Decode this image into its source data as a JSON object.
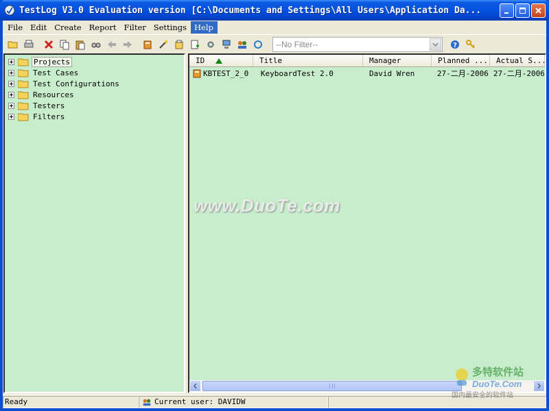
{
  "window": {
    "title": "TestLog V3.0 Evaluation version  [C:\\Documents and Settings\\All Users\\Application Da..."
  },
  "menu": {
    "items": [
      {
        "label": "File"
      },
      {
        "label": "Edit"
      },
      {
        "label": "Create"
      },
      {
        "label": "Report"
      },
      {
        "label": "Filter"
      },
      {
        "label": "Settings"
      },
      {
        "label": "Help",
        "active": true
      }
    ]
  },
  "toolbar": {
    "filter_value": "--No Filter--",
    "icons": [
      "open-folder-icon",
      "print-icon",
      "delete-icon",
      "copy-icon",
      "paste-icon",
      "find-icon",
      "back-arrow-icon",
      "forward-arrow-icon",
      "project-icon",
      "wand-icon",
      "test-case-icon",
      "new-icon",
      "settings-icon",
      "network-icon",
      "users-icon",
      "refresh-icon",
      "help-icon",
      "key-icon"
    ]
  },
  "tree": {
    "items": [
      {
        "label": "Projects",
        "selected": true
      },
      {
        "label": "Test Cases"
      },
      {
        "label": "Test Configurations"
      },
      {
        "label": "Resources"
      },
      {
        "label": "Testers"
      },
      {
        "label": "Filters"
      }
    ]
  },
  "list": {
    "columns": [
      "ID",
      "Title",
      "Manager",
      "Planned ...",
      "Actual S..."
    ],
    "rows": [
      {
        "id": "KBTEST_2_0",
        "title": "KeyboardTest 2.0",
        "manager": "David Wren",
        "planned": "27-二月-2006",
        "actual": "27-二月-2006"
      }
    ],
    "watermark": "www.DuoTe.com"
  },
  "status": {
    "left": "Ready",
    "user": "Current user: DAVIDW"
  },
  "corner_logo": {
    "line1": "多特软件站",
    "line2": "DuoTe.Com",
    "line3": "国内最安全的软件站"
  },
  "colors": {
    "titlebar": "#0553e0",
    "pane_bg": "#c8edcc",
    "menu_active": "#316ac5"
  }
}
